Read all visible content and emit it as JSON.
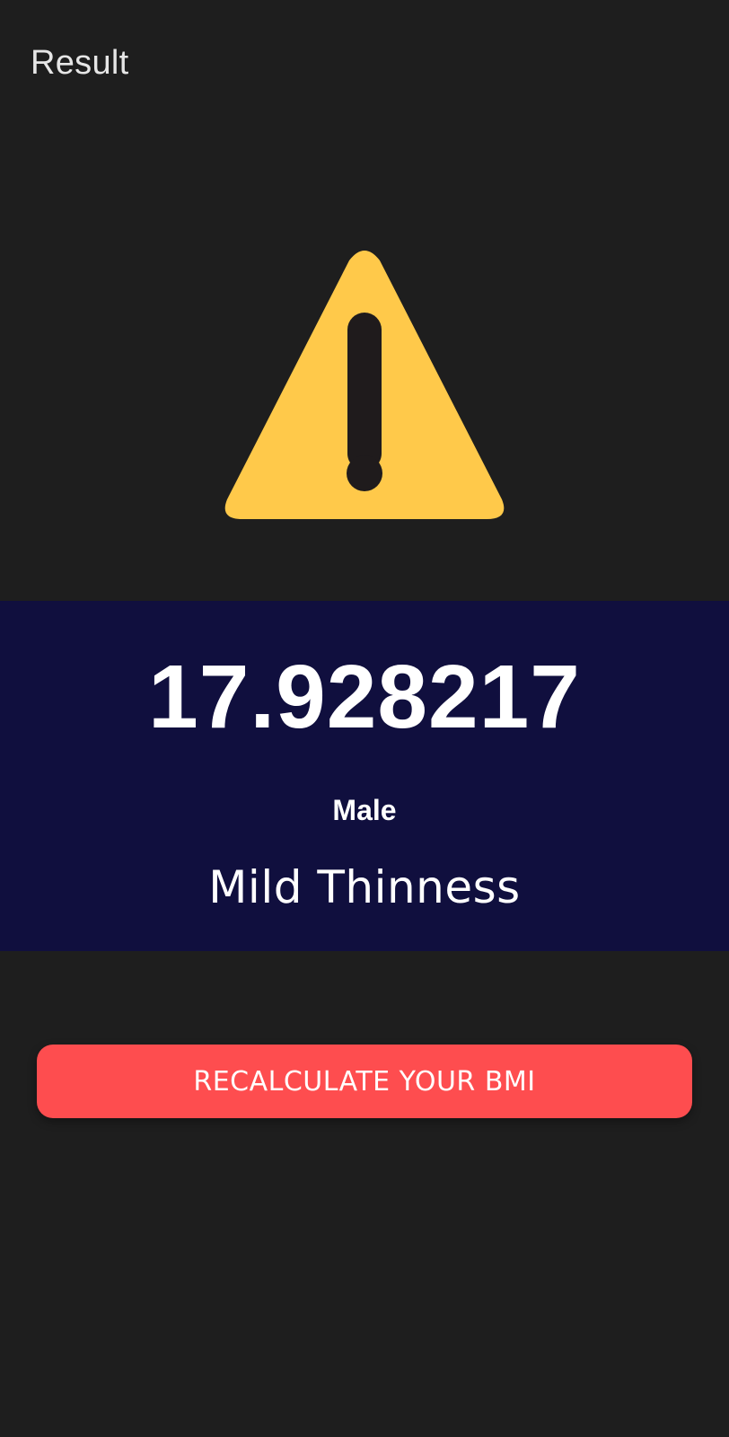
{
  "app_bar": {
    "title": "Result"
  },
  "result": {
    "icon": "warning-icon",
    "icon_color": "#ffc94a",
    "bmi_value": "17.928217",
    "gender": "Male",
    "category": "Mild Thinness",
    "panel_color": "#100f3e"
  },
  "actions": {
    "recalculate_label": "RECALCULATE YOUR BMI",
    "button_color": "#fe4d4f"
  }
}
